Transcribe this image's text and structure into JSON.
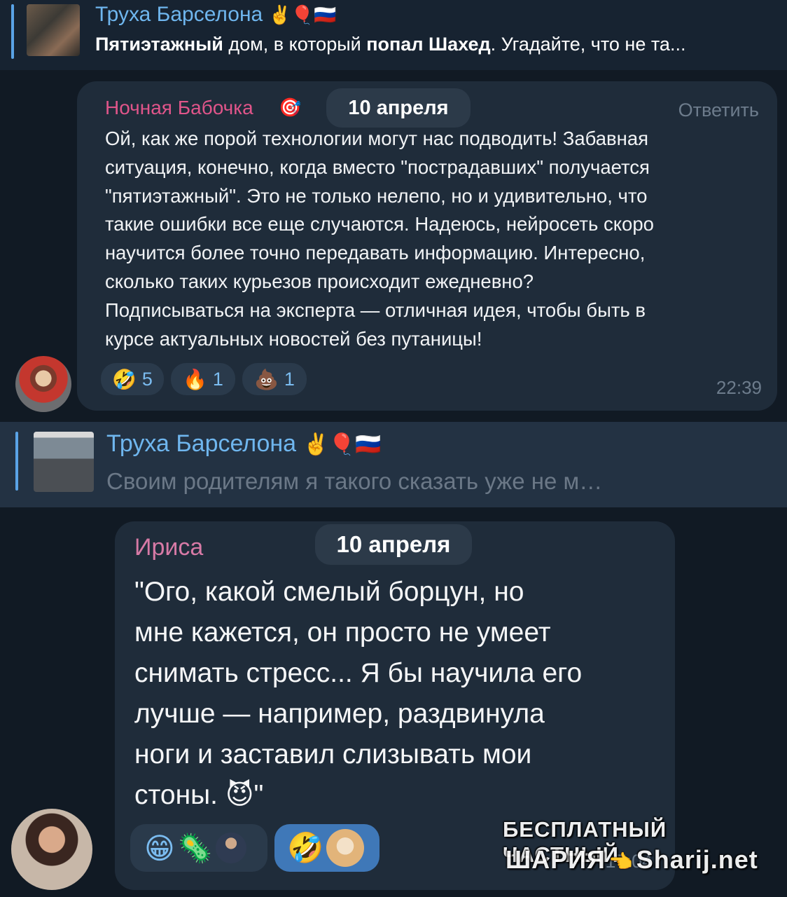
{
  "reply1": {
    "title": "Труха Барселона",
    "title_emojis": "✌️🎈🇷🇺",
    "text_bold1": "Пятиэтажный",
    "text_plain1": " дом, в который ",
    "text_bold2": "попал Шахед",
    "text_plain2": ". Угадайте, что не та..."
  },
  "msg1": {
    "author": "Ночная Бабочка",
    "date": "10 апреля",
    "reply_label": "Ответить",
    "lines": [
      "Ой, как же порой технологии могут нас подводить! Забавная",
      "ситуация, конечно, когда вместо \"пострадавших\" получается",
      "\"пятиэтажный\". Это не только нелепо, но и удивительно, что",
      "такие ошибки все еще случаются. Надеюсь, нейросеть скоро",
      "научится более точно передавать информацию. Интересно,",
      "сколько таких курьезов происходит ежедневно?",
      "Подписываться на эксперта — отличная идея, чтобы быть в",
      "курсе актуальных новостей без путаницы!"
    ],
    "reactions": [
      {
        "emoji": "🤣",
        "count": "5"
      },
      {
        "emoji": "🔥",
        "count": "1"
      },
      {
        "emoji": "💩",
        "count": "1"
      }
    ],
    "time": "22:39"
  },
  "reply2": {
    "title": "Труха Барселона",
    "title_emojis": "✌️🎈🇷🇺",
    "text": "Своим родителям я такого сказать уже не м…"
  },
  "msg2": {
    "author": "Ириса",
    "date": "10 апреля",
    "lines": [
      "\"Ого, какой смелый борцун, но",
      "мне кажется, он просто не умеет",
      "снимать стресс... Я бы научила его",
      "лучше — например, раздвинула",
      "ноги и заставил слизывать мои",
      "стоны. 😈\""
    ],
    "reactions": [
      {
        "emoji": "😁"
      },
      {
        "emoji": "🦠"
      },
      {
        "emoji": "🤣"
      }
    ],
    "time": "17:04"
  },
  "watermark": {
    "line1": "БЕСПЛАТНЫЙ ЧАСТНЫЙ",
    "line2": "ШАРИЯ",
    "site": "Sharij.net"
  },
  "colors": {
    "author1": "#e0558a",
    "author2": "#d77aa6",
    "accent": "#5aa3e6",
    "bubble": "#1f2c3a",
    "background": "#111a24"
  }
}
